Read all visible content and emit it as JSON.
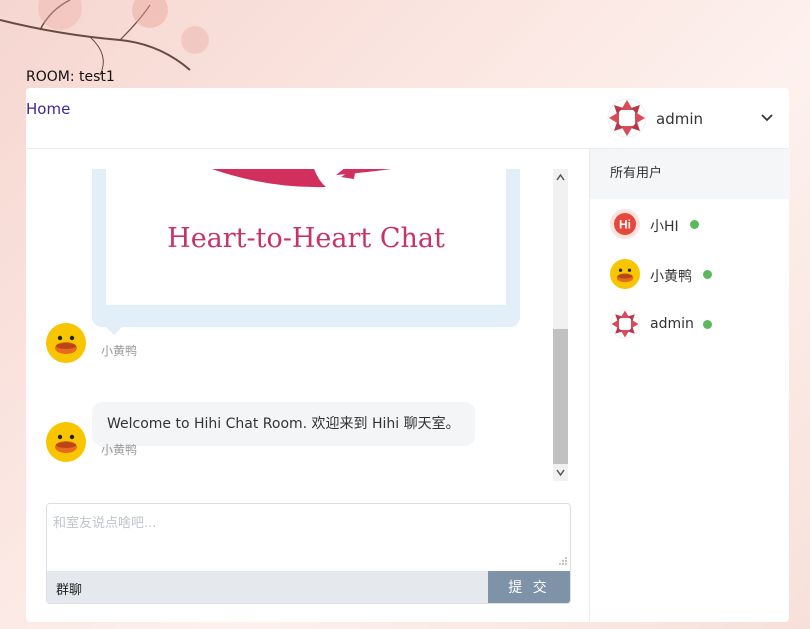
{
  "room": {
    "title": "ROOM: test1"
  },
  "nav": {
    "home": "Home"
  },
  "current_user": {
    "name": "admin",
    "avatar_icon": "red-triangles-avatar-icon"
  },
  "messages": [
    {
      "type": "image",
      "image_caption": "Heart-to-Heart Chat",
      "sender": "小黄鸭",
      "avatar_icon": "yellow-duck-avatar-icon"
    },
    {
      "type": "text",
      "text": "Welcome to Hihi Chat Room. 欢迎来到 Hihi 聊天室。",
      "sender": "小黄鸭",
      "avatar_icon": "yellow-duck-avatar-icon"
    }
  ],
  "composer": {
    "placeholder": "和室友说点啥吧...",
    "mode_label": "群聊",
    "send_label": "提 交"
  },
  "sidebar": {
    "title": "所有用户",
    "users": [
      {
        "name": "小HI",
        "status": "online",
        "avatar_icon": "hi-logo-avatar-icon"
      },
      {
        "name": "小黄鸭",
        "status": "online",
        "avatar_icon": "yellow-duck-avatar-icon"
      },
      {
        "name": "admin",
        "status": "online",
        "avatar_icon": "red-triangles-avatar-icon"
      }
    ]
  },
  "colors": {
    "online": "#5cb85c",
    "send_button": "#7f93a8",
    "brand_pink": "#c8326a",
    "image_frame": "#e2eff9"
  }
}
